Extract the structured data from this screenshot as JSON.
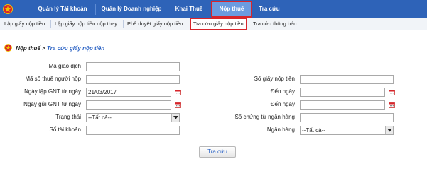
{
  "top_nav": {
    "items": [
      {
        "label": "Quản lý Tài khoản"
      },
      {
        "label": "Quản lý Doanh nghiệp"
      },
      {
        "label": "Khai Thuế"
      },
      {
        "label": "Nộp thuế"
      },
      {
        "label": "Tra cứu"
      }
    ],
    "active_index": 3
  },
  "sub_nav": {
    "items": [
      {
        "label": "Lập giấy nộp tiền"
      },
      {
        "label": "Lập giấy nộp tiền nộp thay"
      },
      {
        "label": "Phê duyệt giấy nộp tiền"
      },
      {
        "label": "Tra cứu giấy nộp tiền"
      },
      {
        "label": "Tra cứu thông báo"
      }
    ],
    "active_index": 3
  },
  "breadcrumb": {
    "root": "Nộp thuế",
    "arrow": ">",
    "current": "Tra cứu giấy nộp tiền"
  },
  "form": {
    "ma_giao_dich": {
      "label": "Mã giao dịch",
      "value": ""
    },
    "ma_so_thue": {
      "label": "Mã số thuế người nộp",
      "value": ""
    },
    "so_giay_nop_tien": {
      "label": "Số giấy nộp tiền",
      "value": ""
    },
    "ngay_lap_tu": {
      "label": "Ngày lập GNT từ ngày",
      "value": "21/03/2017"
    },
    "ngay_lap_den": {
      "label": "Đến ngày",
      "value": ""
    },
    "ngay_gui_tu": {
      "label": "Ngày gửi GNT từ ngày",
      "value": ""
    },
    "ngay_gui_den": {
      "label": "Đến ngày",
      "value": ""
    },
    "trang_thai": {
      "label": "Trạng thái",
      "value": "--Tất cả--"
    },
    "so_chung_tu": {
      "label": "Số chứng từ ngân hàng",
      "value": ""
    },
    "so_tai_khoan": {
      "label": "Số tài khoản",
      "value": ""
    },
    "ngan_hang": {
      "label": "Ngân hàng",
      "value": "--Tất cả--"
    },
    "submit_label": "Tra cứu"
  },
  "colors": {
    "nav_bg": "#2e63b8",
    "highlight": "#d8252b",
    "link": "#2a62c4"
  }
}
